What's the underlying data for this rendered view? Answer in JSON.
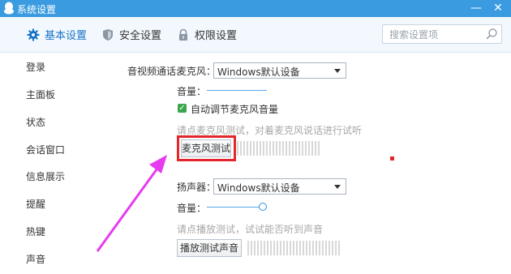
{
  "window": {
    "title": "系统设置",
    "minimize": "—",
    "close": "✕"
  },
  "tabs": [
    {
      "label": "基本设置",
      "icon": "gear-icon"
    },
    {
      "label": "安全设置",
      "icon": "shield-icon"
    },
    {
      "label": "权限设置",
      "icon": "lock-icon"
    }
  ],
  "search": {
    "placeholder": "搜索设置项"
  },
  "sidebar": {
    "items": [
      "登录",
      "主面板",
      "状态",
      "会话窗口",
      "信息展示",
      "提醒",
      "热键",
      "声音"
    ]
  },
  "av": {
    "section_label": "音视频通话:",
    "mic_label": "麦克风：",
    "mic_device": "Windows默认设备",
    "mic_volume_label": "音量：",
    "auto_adjust_label": "自动调节麦克风音量",
    "auto_adjust_checked": true,
    "mic_hint": "请点麦克风测试，对着麦克风说话进行试听",
    "mic_test_button": "麦克风测试",
    "speaker_label": "扬声器：",
    "speaker_device": "Windows默认设备",
    "speaker_volume_label": "音量：",
    "speaker_hint": "请点播放测试，试试能否听到声音",
    "speaker_test_button": "播放测试声音"
  },
  "colors": {
    "titlebar": "#3a9be0",
    "accent": "#1a72c6",
    "highlight": "#e3262b",
    "annotation_arrow": "#e63cf0",
    "checkbox": "#3aa64b"
  }
}
